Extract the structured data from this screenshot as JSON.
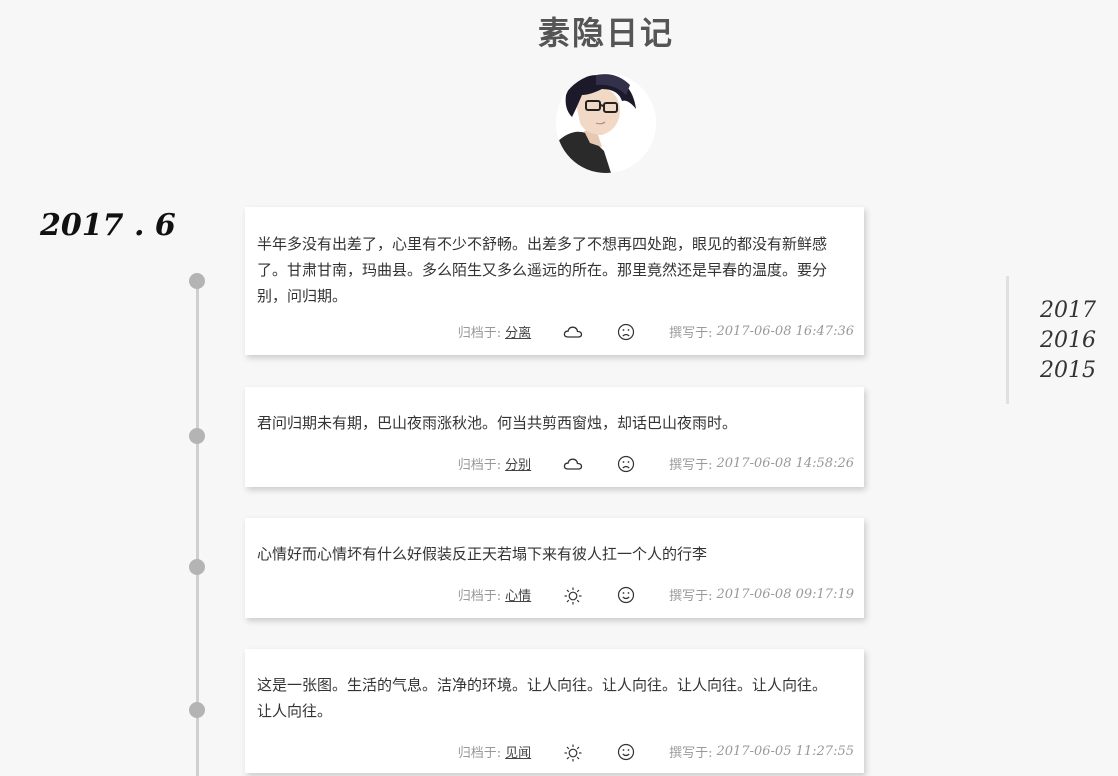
{
  "site": {
    "title": "素隐日记"
  },
  "timeline": {
    "month_label": "2017 . 6",
    "entries": [
      {
        "content": "半年多没有出差了，心里有不少不舒畅。出差多了不想再四处跑，眼见的都没有新鲜感了。甘肃甘南，玛曲县。多么陌生又多么遥远的所在。那里竟然还是早春的温度。要分别，问归期。",
        "category_label": "归档于:",
        "category": "分离",
        "weather_icon": "cloud-icon",
        "mood_icon": "sad-face-icon",
        "date_label": "撰写于:",
        "date": "2017-06-08 16:47:36"
      },
      {
        "content": "君问归期未有期，巴山夜雨涨秋池。何当共剪西窗烛，却话巴山夜雨时。",
        "category_label": "归档于:",
        "category": "分别",
        "weather_icon": "cloud-icon",
        "mood_icon": "sad-face-icon",
        "date_label": "撰写于:",
        "date": "2017-06-08 14:58:26"
      },
      {
        "content": "心情好而心情坏有什么好假装反正天若塌下来有彼人扛一个人的行李",
        "category_label": "归档于:",
        "category": "心情",
        "weather_icon": "sun-icon",
        "mood_icon": "happy-face-icon",
        "date_label": "撰写于:",
        "date": "2017-06-08 09:17:19"
      },
      {
        "content": "这是一张图。生活的气息。洁净的环境。让人向往。让人向往。让人向往。让人向往。让人向往。",
        "category_label": "归档于:",
        "category": "见闻",
        "weather_icon": "sun-icon",
        "mood_icon": "happy-face-icon",
        "date_label": "撰写于:",
        "date": "2017-06-05 11:27:55"
      }
    ]
  },
  "year_nav": {
    "years": [
      "2017",
      "2016",
      "2015"
    ]
  }
}
